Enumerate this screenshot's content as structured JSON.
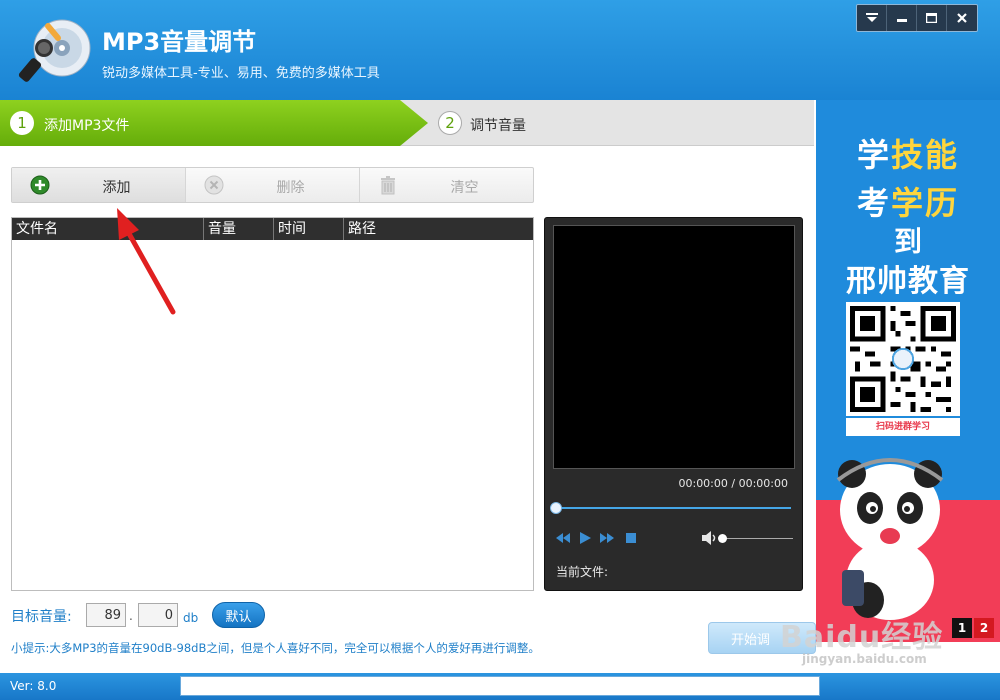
{
  "app": {
    "title": "MP3音量调节",
    "subtitle": "锐动多媒体工具-专业、易用、免费的多媒体工具",
    "window_controls": [
      "menu-icon",
      "minimize-icon",
      "maximize-icon",
      "close-icon"
    ]
  },
  "steps": [
    {
      "num": "1",
      "label": "添加MP3文件",
      "active": true
    },
    {
      "num": "2",
      "label": "调节音量",
      "active": false
    }
  ],
  "toolbar": {
    "add_label": "添加",
    "delete_label": "删除",
    "clear_label": "清空"
  },
  "file_list": {
    "columns": [
      "文件名",
      "音量",
      "时间",
      "路径"
    ],
    "rows": []
  },
  "player": {
    "time": "00:00:00 / 00:00:00",
    "current_file_label": "当前文件:",
    "progress": 0,
    "volume": 0
  },
  "settings": {
    "target_label": "目标音量:",
    "volume_int": "89",
    "volume_dec": "0",
    "separator": ".",
    "unit": "db",
    "default_label": "默认",
    "tip": "小提示:大多MP3的音量在90dB-98dB之间，但是个人喜好不同，完全可以根据个人的爱好再进行调整。",
    "start_label": "开始调"
  },
  "ad": {
    "line1_a": "学",
    "line1_b": "技能",
    "line2_a": "考",
    "line2_b": "学历",
    "line3": "到",
    "line4": "邢帅教育",
    "qr_caption": "扫码进群学习",
    "pages": [
      "1",
      "2"
    ]
  },
  "status": {
    "version": "Ver: 8.0"
  },
  "watermark": {
    "main": "Baidu经验",
    "sub": "jingyan.baidu.com"
  },
  "colors": {
    "header_blue": "#1a83d3",
    "step_green": "#65ad0a",
    "accent_blue": "#1f7fc8",
    "arrow_red": "#e02020"
  }
}
